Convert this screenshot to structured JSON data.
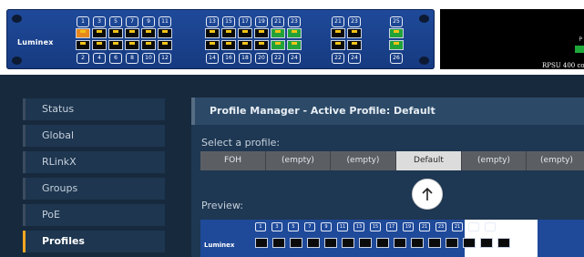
{
  "device": {
    "brand": "Luminex",
    "ports_top": [
      "1",
      "3",
      "5",
      "7",
      "9",
      "11",
      "13",
      "15",
      "17",
      "19",
      "21",
      "23",
      "21",
      "23",
      "25"
    ],
    "ports_bottom": [
      "2",
      "4",
      "6",
      "8",
      "10",
      "12",
      "14",
      "16",
      "18",
      "20",
      "22",
      "24",
      "22",
      "24",
      "26"
    ],
    "psu_label": "RPSU 400 co",
    "psu_letter": "P"
  },
  "sidebar": {
    "items": [
      {
        "label": "Status"
      },
      {
        "label": "Global"
      },
      {
        "label": "RLinkX"
      },
      {
        "label": "Groups"
      },
      {
        "label": "PoE"
      },
      {
        "label": "Profiles"
      }
    ],
    "active": "Profiles"
  },
  "panel": {
    "title": "Profile Manager - Active Profile: Default",
    "select_label": "Select a profile:",
    "preview_label": "Preview:",
    "profiles": [
      "FOH",
      "(empty)",
      "(empty)",
      "Default",
      "(empty)",
      "(empty)"
    ],
    "active_profile": "Default"
  },
  "preview": {
    "brand": "Luminex",
    "ports": [
      "1",
      "3",
      "5",
      "7",
      "9",
      "11",
      "13",
      "15",
      "17",
      "19",
      "21",
      "23",
      "21",
      "23",
      "25"
    ]
  },
  "colors": {
    "accent": "#f5a623",
    "panel": "#1e3752",
    "page": "#17293d"
  }
}
